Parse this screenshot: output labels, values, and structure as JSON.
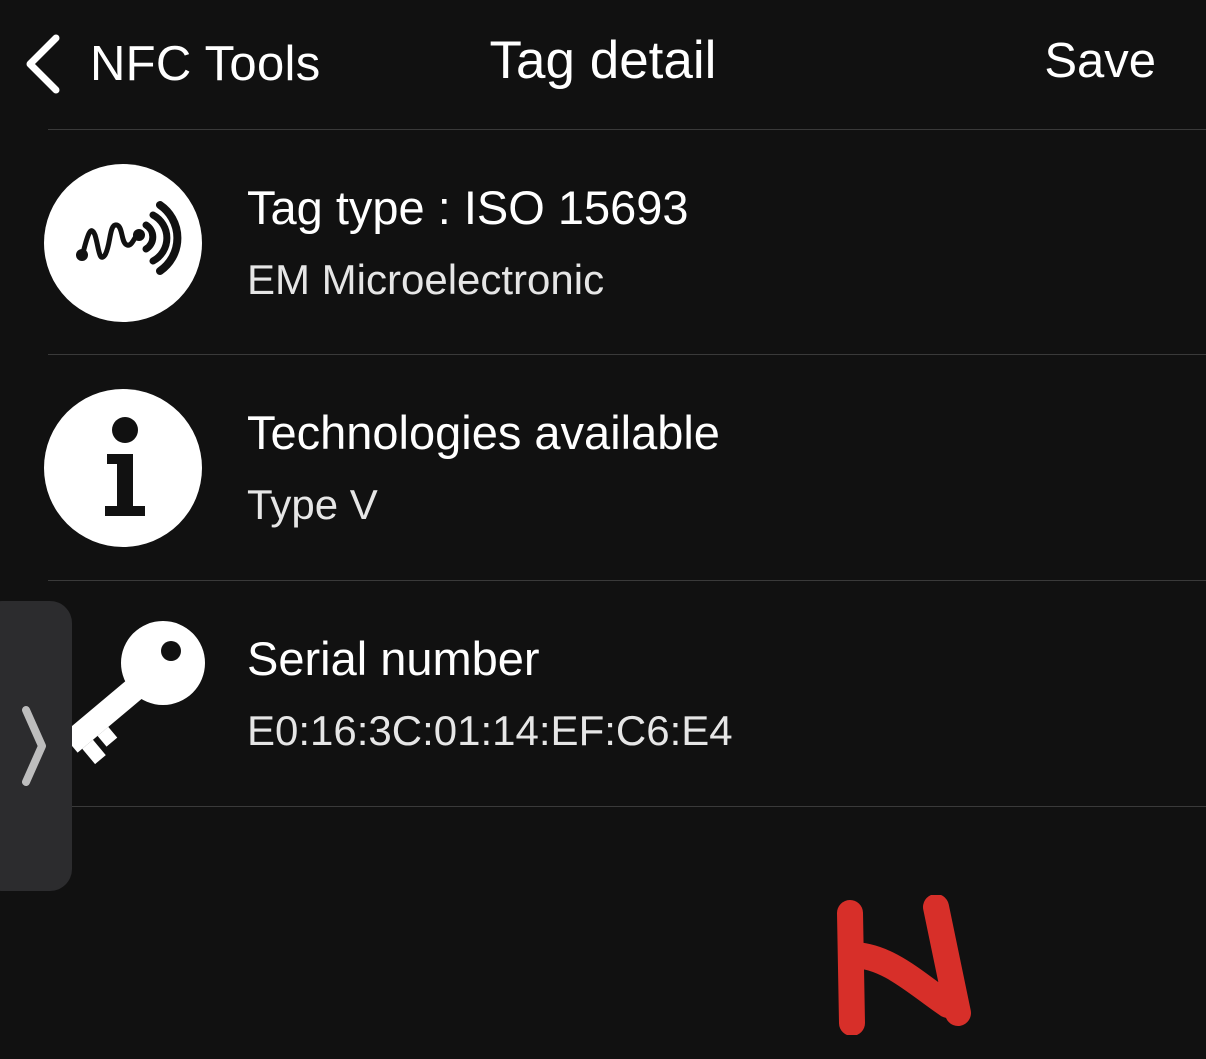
{
  "header": {
    "back_label": "NFC Tools",
    "title": "Tag detail",
    "save_label": "Save"
  },
  "rows": [
    {
      "icon": "nfc-signal-icon",
      "title": "Tag type : ISO 15693",
      "subtitle": "EM Microelectronic"
    },
    {
      "icon": "info-icon",
      "title": "Technologies available",
      "subtitle": "Type V"
    },
    {
      "icon": "key-icon",
      "title": "Serial number",
      "subtitle": "E0:16:3C:01:14:EF:C6:E4"
    }
  ],
  "drawer": {
    "icon": "chevron-right-icon"
  },
  "colors": {
    "background": "#111111",
    "text": "#ffffff",
    "divider": "#3a3a3a",
    "drawer": "#2c2c2e",
    "mark": "#e8322b"
  }
}
